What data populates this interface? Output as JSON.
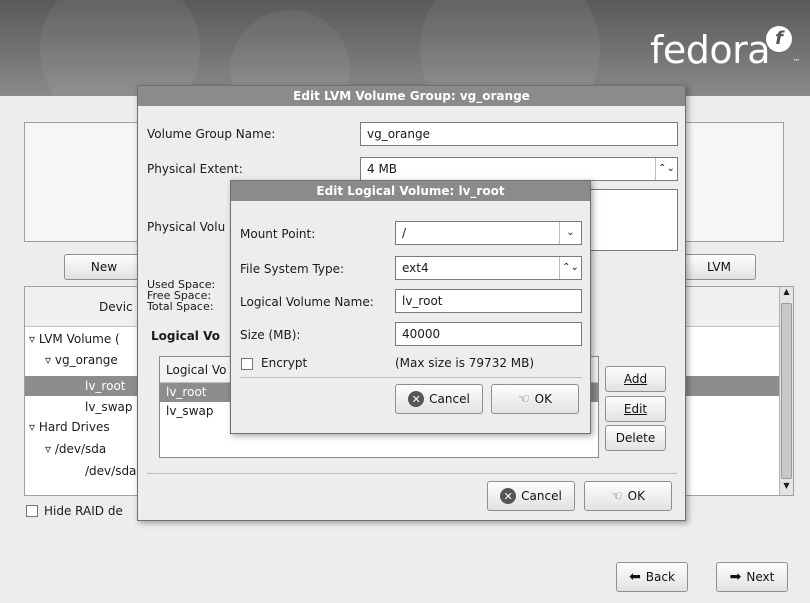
{
  "brand": {
    "logo_text": "fedora",
    "logo_mark": "f",
    "logo_tm": "™"
  },
  "main": {
    "buttons": {
      "new": "New",
      "lvm": "LVM"
    },
    "device_header": "Devic",
    "tree": [
      "LVM Volume (",
      "vg_orange",
      "lv_root",
      "lv_swap",
      "Hard Drives",
      "/dev/sda",
      "/dev/sda"
    ],
    "hide_raid_label": "Hide RAID de"
  },
  "nav": {
    "back": "Back",
    "next": "Next"
  },
  "vg_dialog": {
    "title": "Edit LVM Volume Group: vg_orange",
    "vg_name_label": "Volume Group Name:",
    "vg_name_value": "vg_orange",
    "pe_label": "Physical Extent:",
    "pe_value": "4 MB",
    "pv_label": "Physical Volu",
    "used_label": "Used Space:",
    "free_label": "Free Space:",
    "total_label": "Total Space:",
    "lv_section_label": "Logical Vo",
    "lv_column": "Logical Vo",
    "lv_rows": [
      "lv_root",
      "lv_swap"
    ],
    "add": "Add",
    "edit": "Edit",
    "delete": "Delete",
    "cancel": "Cancel",
    "ok": "OK"
  },
  "lv_dialog": {
    "title": "Edit Logical Volume: lv_root",
    "mount_label": "Mount Point:",
    "mount_value": "/",
    "fs_label": "File System Type:",
    "fs_value": "ext4",
    "lvname_label": "Logical Volume Name:",
    "lvname_value": "lv_root",
    "size_label": "Size (MB):",
    "size_value": "40000",
    "encrypt_label": "Encrypt",
    "max_size": "(Max size is 79732 MB)",
    "cancel": "Cancel",
    "ok": "OK"
  }
}
